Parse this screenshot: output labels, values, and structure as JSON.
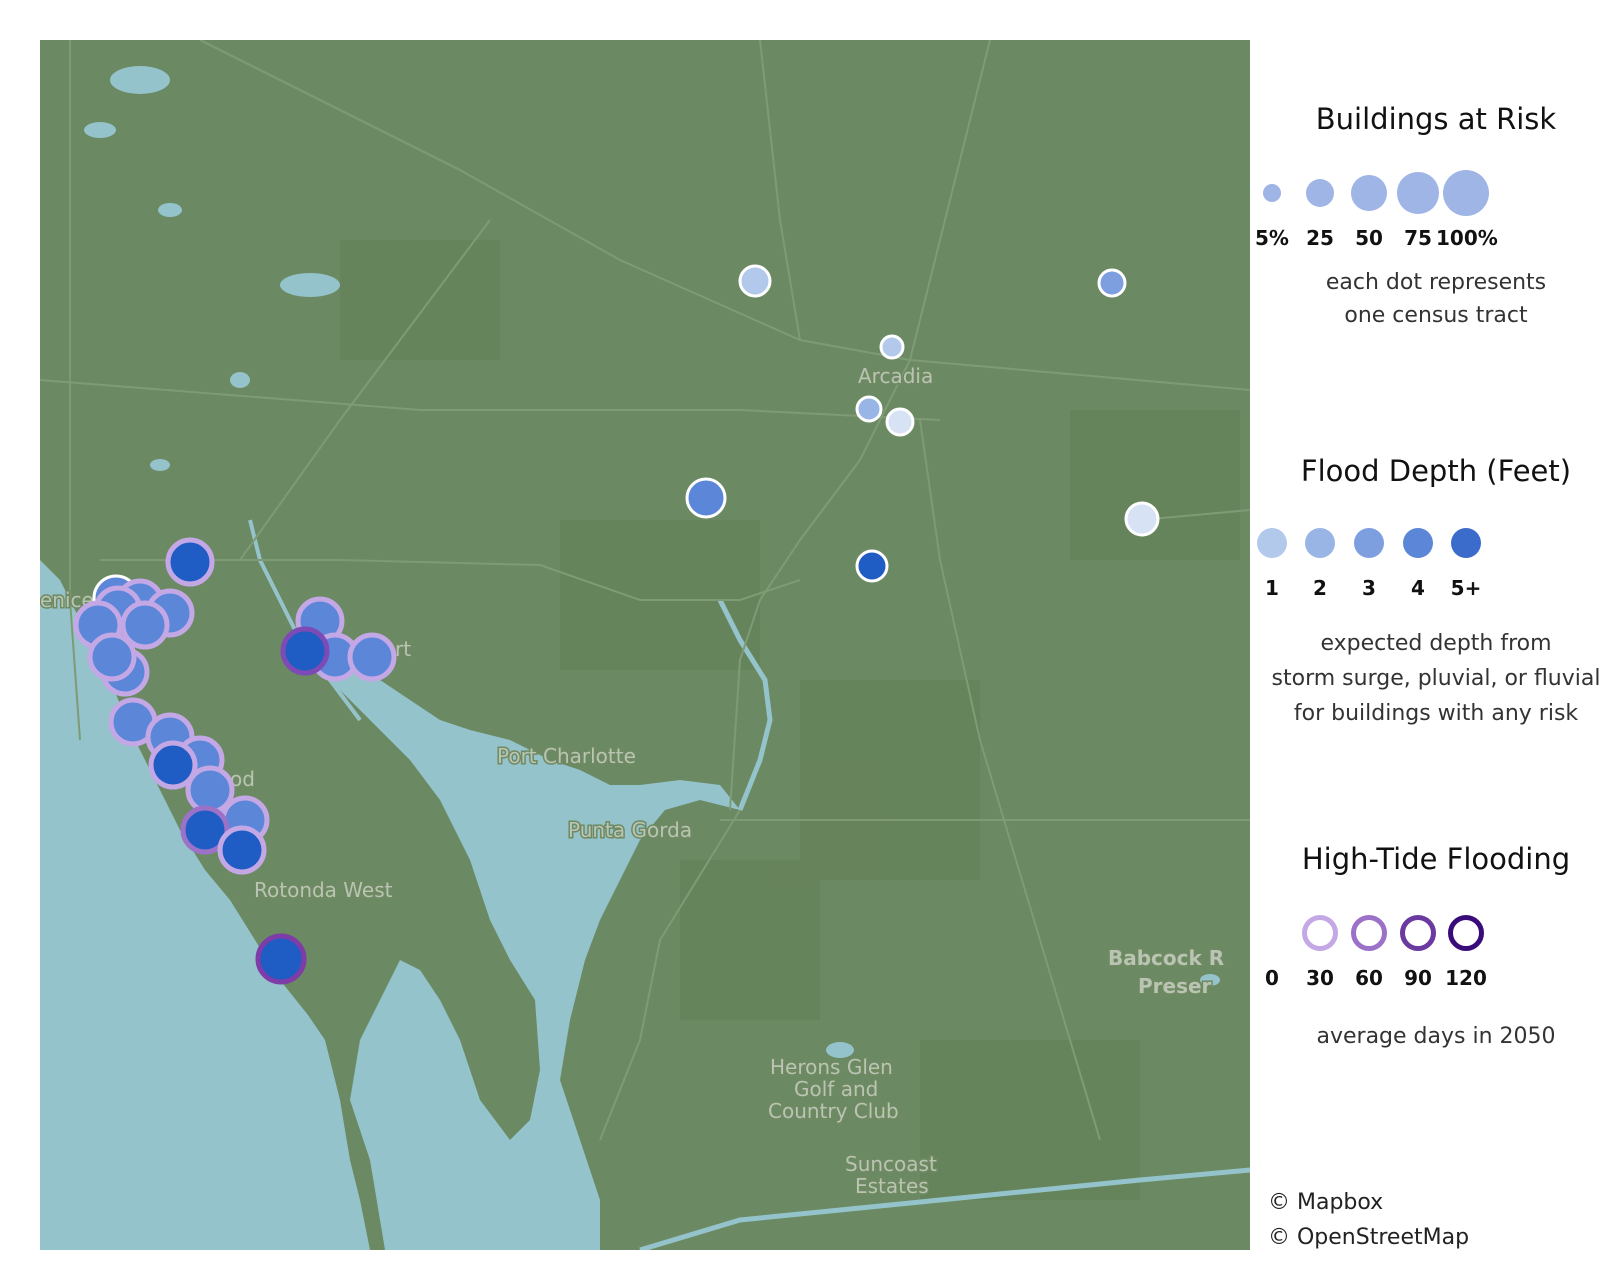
{
  "map": {
    "colors": {
      "land": "#6b8962",
      "water": "#94c3cb",
      "road": "#7e9a74",
      "label": "#b9c4b3"
    },
    "place_labels": [
      {
        "text": "enice",
        "class": ""
      },
      {
        "text": "Arcadia",
        "class": ""
      },
      {
        "text": "rt",
        "class": ""
      },
      {
        "text": "Port Charlotte",
        "class": ""
      },
      {
        "text": "Punta Gorda",
        "class": ""
      },
      {
        "text": "od",
        "class": ""
      },
      {
        "text": "Rotonda West",
        "class": ""
      },
      {
        "text": "Babcock R",
        "class": "bold"
      },
      {
        "text": "Preser",
        "class": "bold"
      },
      {
        "text": "Herons Glen",
        "class": ""
      },
      {
        "text": "Golf and",
        "class": ""
      },
      {
        "text": "Country Club",
        "class": ""
      },
      {
        "text": "Suncoast",
        "class": ""
      },
      {
        "text": "Estates",
        "class": ""
      }
    ]
  },
  "legend": {
    "buildings": {
      "title": "Buildings at Risk",
      "items": [
        {
          "label": "5%",
          "value": 5
        },
        {
          "label": "25",
          "value": 25
        },
        {
          "label": "50",
          "value": 50
        },
        {
          "label": "75",
          "value": 75
        },
        {
          "label": "100%",
          "value": 100
        }
      ],
      "note_line1": "each dot represents",
      "note_line2": "one census tract"
    },
    "depth": {
      "title": "Flood Depth (Feet)",
      "items": [
        {
          "label": "1",
          "color": "#b3c9ec"
        },
        {
          "label": "2",
          "color": "#98b5e6"
        },
        {
          "label": "3",
          "color": "#7d9fe0"
        },
        {
          "label": "4",
          "color": "#5c86d8"
        },
        {
          "label": "5+",
          "color": "#3b6ccc"
        }
      ],
      "note_line1": "expected depth from",
      "note_line2": "storm surge, pluvial, or fluvial",
      "note_line3": "for buildings with any risk"
    },
    "tide": {
      "title": "High-Tide Flooding",
      "items": [
        {
          "label": "0",
          "color": "none"
        },
        {
          "label": "30",
          "color": "#c4a8e6"
        },
        {
          "label": "60",
          "color": "#9b72c8"
        },
        {
          "label": "90",
          "color": "#6a3aa0"
        },
        {
          "label": "120",
          "color": "#3a0c7a"
        }
      ],
      "note": "average days in 2050"
    }
  },
  "credits": {
    "line1": "© Mapbox",
    "line2": "© OpenStreetMap"
  }
}
